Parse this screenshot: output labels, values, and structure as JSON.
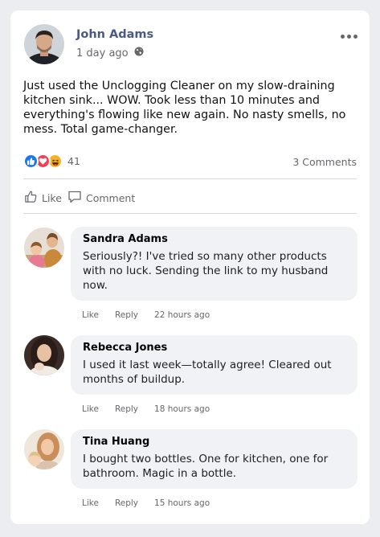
{
  "post": {
    "author": "John Adams",
    "time": "1 day ago",
    "privacy_icon": "globe-icon",
    "more_icon": "more-options-icon",
    "text": "Just used the Unclogging Cleaner on my slow-draining kitchen sink... WOW. Took less than 10 minutes and everything's flowing like new again. No nasty smells, no mess. Total game-changer.",
    "reactions": [
      "like-reaction-icon",
      "love-reaction-icon",
      "haha-reaction-icon"
    ],
    "reaction_count": "41",
    "comments_count": "3 Comments"
  },
  "actions": {
    "like": "Like",
    "comment": "Comment"
  },
  "comments": [
    {
      "name": "Sandra Adams",
      "text": "Seriously?! I've tried so many other products with no luck. Sending the link to my husband now.",
      "like": "Like",
      "reply": "Reply",
      "time": "22 hours ago"
    },
    {
      "name": "Rebecca Jones",
      "text": "I used it last week—totally agree! Cleared out months of buildup.",
      "like": "Like",
      "reply": "Reply",
      "time": "18 hours ago"
    },
    {
      "name": "Tina Huang",
      "text": "I bought two bottles. One for kitchen, one for bathroom. Magic in a bottle.",
      "like": "Like",
      "reply": "Reply",
      "time": "15 hours ago"
    }
  ],
  "colors": {
    "name_link": "#4b5a82",
    "like_blue": "#1877f2",
    "love_red": "#f33e58",
    "haha_yellow": "#f7b125",
    "bubble_bg": "#f0f2f5"
  }
}
